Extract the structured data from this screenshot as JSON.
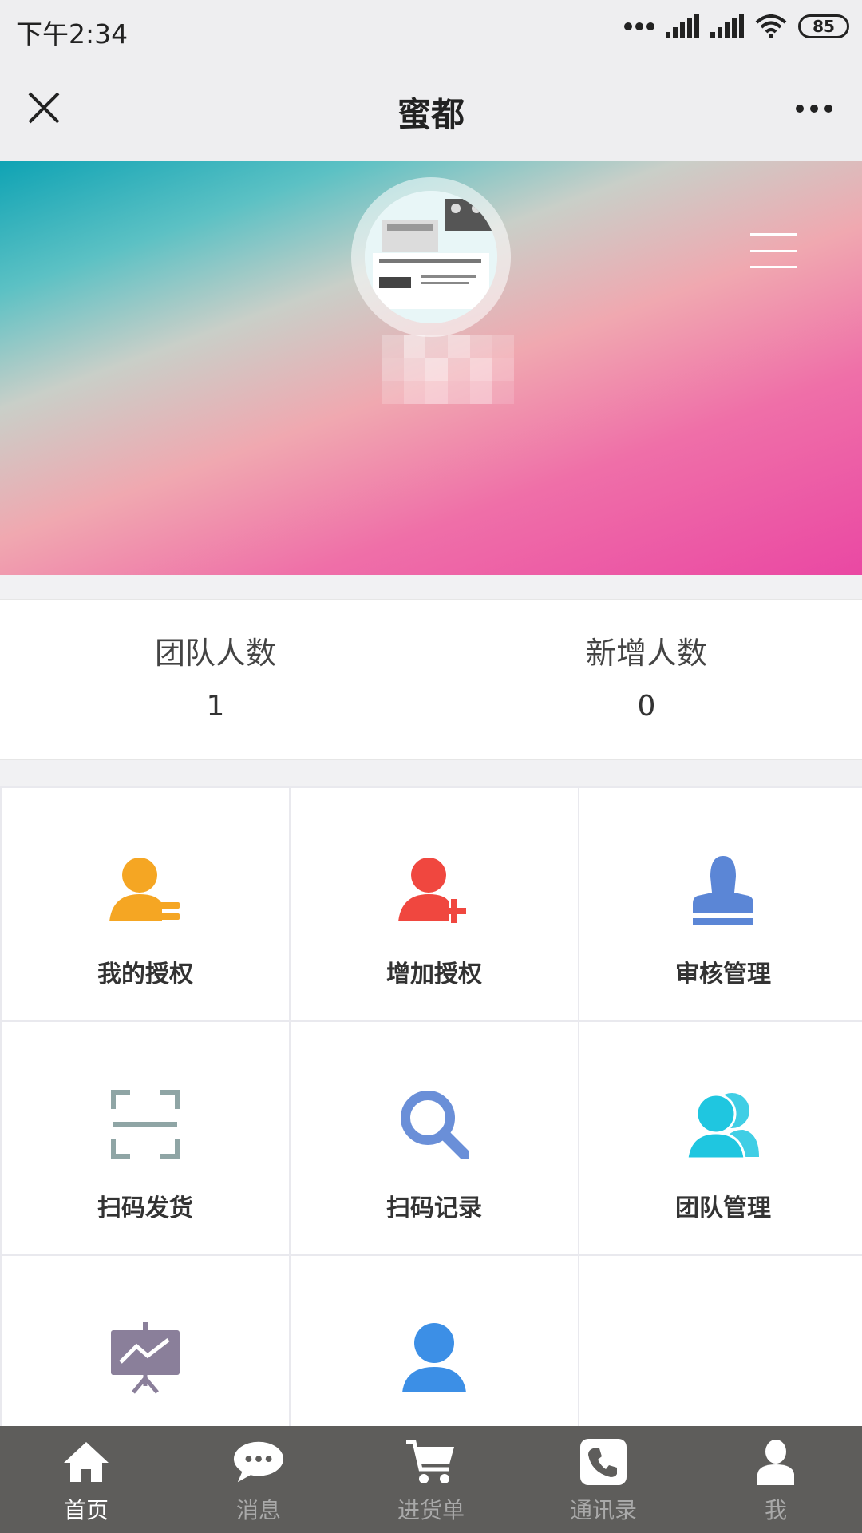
{
  "status_bar": {
    "time": "下午2:34",
    "battery": "85"
  },
  "title_bar": {
    "title": "蜜都"
  },
  "stats": [
    {
      "label": "团队人数",
      "value": "1"
    },
    {
      "label": "新增人数",
      "value": "0"
    }
  ],
  "grid": {
    "items": [
      {
        "label": "我的授权",
        "icon": "user-list-icon",
        "color": "#f5a623"
      },
      {
        "label": "增加授权",
        "icon": "user-add-icon",
        "color": "#f0473f"
      },
      {
        "label": "审核管理",
        "icon": "stamp-icon",
        "color": "#5b86d6"
      },
      {
        "label": "扫码发货",
        "icon": "scan-icon",
        "color": "#8fa5a5"
      },
      {
        "label": "扫码记录",
        "icon": "search-icon",
        "color": "#6a8fd8"
      },
      {
        "label": "团队管理",
        "icon": "team-icon",
        "color": "#1fc6e0"
      },
      {
        "label": "",
        "icon": "presentation-chart-icon",
        "color": "#8a7f9a"
      },
      {
        "label": "",
        "icon": "profile-icon",
        "color": "#3c8fe6"
      }
    ]
  },
  "tab_bar": {
    "tabs": [
      {
        "label": "首页",
        "icon": "home-icon",
        "active": true
      },
      {
        "label": "消息",
        "icon": "chat-icon",
        "active": false
      },
      {
        "label": "进货单",
        "icon": "cart-icon",
        "active": false
      },
      {
        "label": "通讯录",
        "icon": "phone-icon",
        "active": false
      },
      {
        "label": "我",
        "icon": "user-icon",
        "active": false
      }
    ]
  }
}
